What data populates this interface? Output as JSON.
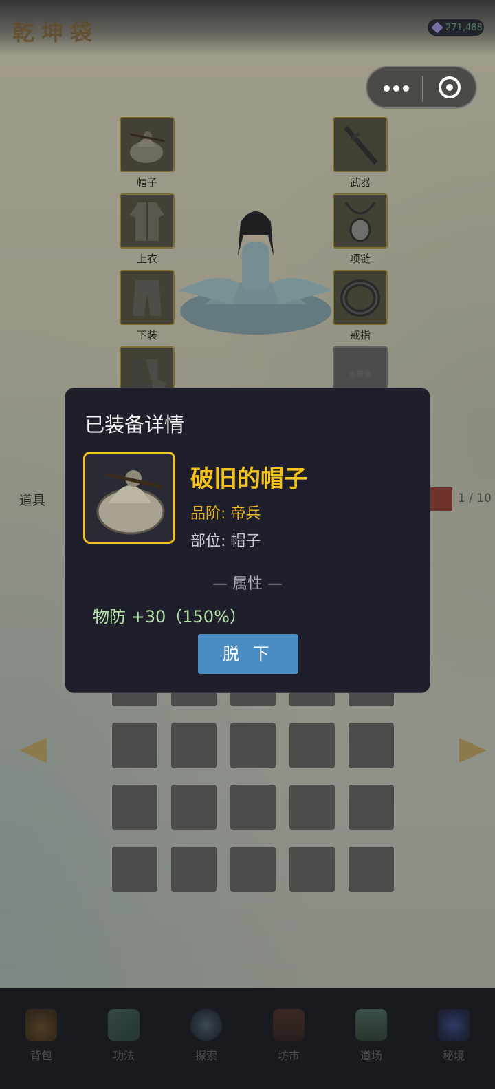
{
  "app": {
    "title": "乾坤袋",
    "currency": "271,488"
  },
  "equipment": {
    "slots": [
      {
        "label": "帽子"
      },
      {
        "label": "武器"
      },
      {
        "label": "上衣"
      },
      {
        "label": "项链"
      },
      {
        "label": "下装"
      },
      {
        "label": "戒指"
      },
      {
        "label": ""
      },
      {
        "label": "未装备"
      }
    ]
  },
  "inventory": {
    "section_label": "道具",
    "pager": "1 / 10"
  },
  "modal": {
    "title": "已装备详情",
    "item_name": "破旧的帽子",
    "grade": "品阶: 帝兵",
    "part": "部位: 帽子",
    "attr_header": "— 属性 —",
    "attr_line": "物防 +30（150%）",
    "unequip_label": "脱 下"
  },
  "nav": [
    {
      "label": "背包",
      "icon": "bag-icon"
    },
    {
      "label": "功法",
      "icon": "scroll-icon"
    },
    {
      "label": "探索",
      "icon": "swords-icon"
    },
    {
      "label": "坊市",
      "icon": "market-icon"
    },
    {
      "label": "道场",
      "icon": "mountain-icon"
    },
    {
      "label": "秘境",
      "icon": "portal-icon"
    }
  ],
  "colors": {
    "accent_gold": "#f3c21b",
    "button_blue": "#4a8bc2",
    "attr_green": "#b4e3a7"
  }
}
